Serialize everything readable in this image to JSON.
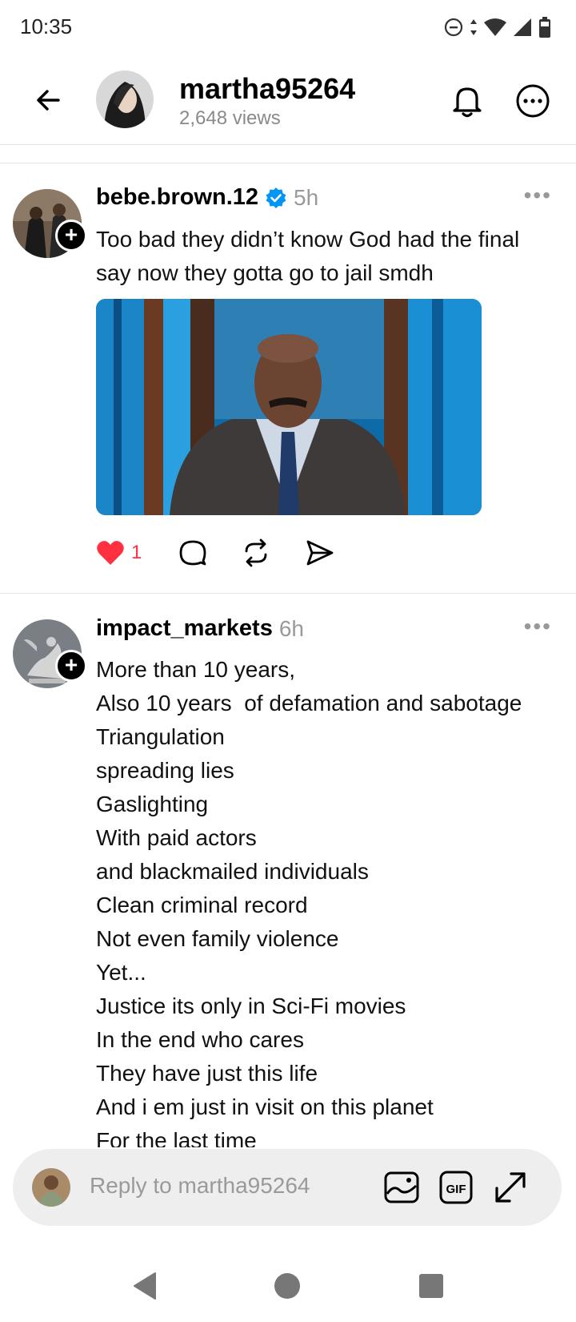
{
  "status": {
    "time": "10:35"
  },
  "header": {
    "title": "martha95264",
    "subtitle": "2,648 views"
  },
  "posts": [
    {
      "username": "bebe.brown.12",
      "verified": true,
      "time": "5h",
      "text": "Too bad they didn’t know God had the final say now they gotta go to jail smdh",
      "like_count": "1"
    },
    {
      "username": "impact_markets",
      "verified": false,
      "time": "6h",
      "lines": [
        "More than 10 years,",
        "Also 10 years  of defamation and sabotage",
        "Triangulation",
        "spreading lies",
        "Gaslighting",
        "With paid actors",
        "and blackmailed individuals",
        "Clean criminal record",
        "Not even family violence",
        "Yet...",
        "Justice its only in Sci-Fi movies",
        "In the end who cares",
        "They have just this life",
        "And i em just in visit on this planet",
        "For the last time"
      ]
    }
  ],
  "reply": {
    "placeholder": "Reply to martha95264"
  },
  "colors": {
    "like": "#ff3040",
    "verified": "#0095f6",
    "muted": "#9a9a9a"
  },
  "icons": [
    "back-arrow-icon",
    "bell-icon",
    "more-icon",
    "heart-icon",
    "comment-icon",
    "repost-icon",
    "share-icon",
    "image-icon",
    "gif-icon",
    "expand-icon"
  ]
}
